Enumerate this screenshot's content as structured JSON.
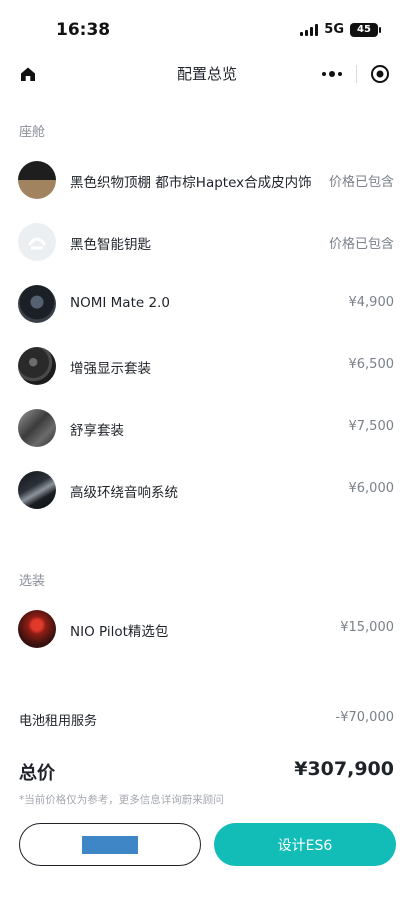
{
  "status_bar": {
    "time": "16:38",
    "network": "5G",
    "battery": "45"
  },
  "nav": {
    "title": "配置总览"
  },
  "sections": {
    "cabin": {
      "title": "座舱",
      "items": [
        {
          "name": "黑色织物顶棚 都市棕Haptex合成皮内饰",
          "price": "价格已包含",
          "thumb_icon": "two-tone-trim-swatch"
        },
        {
          "name": "黑色智能钥匙",
          "price": "价格已包含",
          "thumb_icon": "nio-key-logo"
        },
        {
          "name": "NOMI Mate 2.0",
          "price": "¥4,900",
          "thumb_icon": "nomi-dashboard-photo"
        },
        {
          "name": "增强显示套装",
          "price": "¥6,500",
          "thumb_icon": "steering-wheel-photo"
        },
        {
          "name": "舒享套装",
          "price": "¥7,500",
          "thumb_icon": "seat-photo"
        },
        {
          "name": "高级环绕音响系统",
          "price": "¥6,000",
          "thumb_icon": "speaker-photo"
        }
      ]
    },
    "options": {
      "title": "选装",
      "items": [
        {
          "name": "NIO Pilot精选包",
          "price": "¥15,000",
          "thumb_icon": "red-taillight-photo"
        }
      ]
    }
  },
  "battery_service": {
    "label": "电池租用服务",
    "value": "-¥70,000"
  },
  "total": {
    "label": "总价",
    "value": "¥307,900"
  },
  "disclaimer": "*当前价格仅为参考，更多信息详询蔚来顾问",
  "buttons": {
    "left_label": "",
    "right_label": "设计ES6"
  },
  "colors": {
    "accent": "#12bdb8",
    "text_primary": "#1f2329",
    "text_secondary": "#7b8089"
  }
}
